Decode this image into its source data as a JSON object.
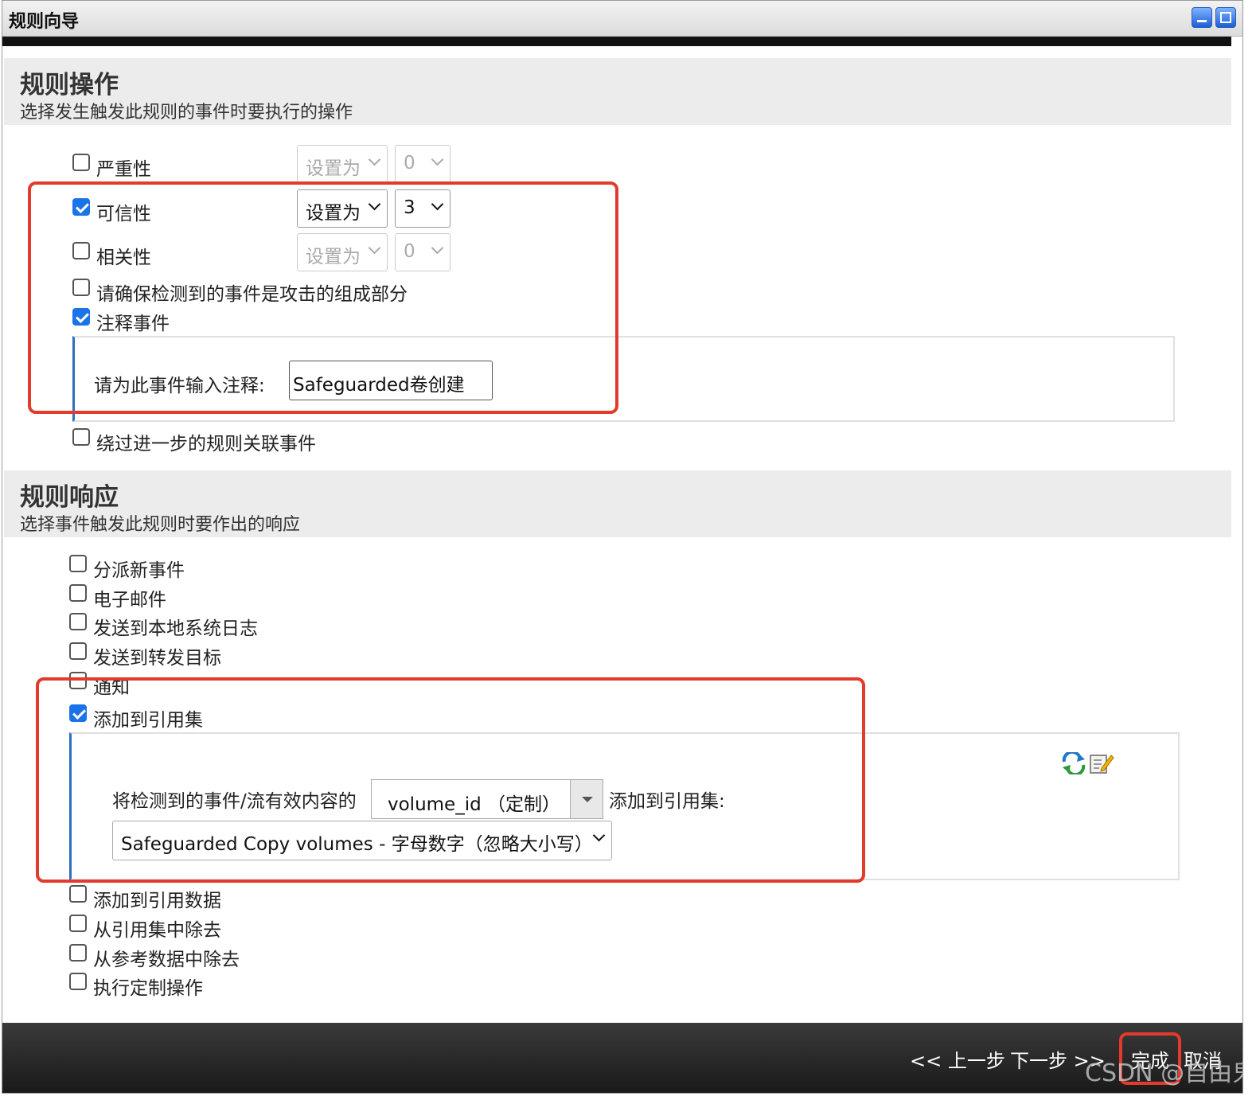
{
  "window": {
    "title": "规则向导"
  },
  "actions": {
    "title": "规则操作",
    "subtitle": "选择发生触发此规则的事件时要执行的操作",
    "severity": {
      "label": "严重性",
      "checked": false,
      "mode": "设置为",
      "value": "0"
    },
    "credibility": {
      "label": "可信性",
      "checked": true,
      "mode": "设置为",
      "value": "3"
    },
    "relevance": {
      "label": "相关性",
      "checked": false,
      "mode": "设置为",
      "value": "0"
    },
    "ensure_part_of_attack": {
      "label": "请确保检测到的事件是攻击的组成部分",
      "checked": false
    },
    "annotate_event": {
      "label": "注释事件",
      "checked": true
    },
    "annotation": {
      "label": "请为此事件输入注释:",
      "value": "Safeguarded卷创建"
    },
    "bypass_correlation": {
      "label": "绕过进一步的规则关联事件",
      "checked": false
    }
  },
  "responses": {
    "title": "规则响应",
    "subtitle": "选择事件触发此规则时要作出的响应",
    "dispatch_new_event": {
      "label": "分派新事件",
      "checked": false
    },
    "email": {
      "label": "电子邮件",
      "checked": false
    },
    "send_to_syslog": {
      "label": "发送到本地系统日志",
      "checked": false
    },
    "send_to_forward_target": {
      "label": "发送到转发目标",
      "checked": false
    },
    "notify": {
      "label": "通知",
      "checked": false
    },
    "add_to_reference_set": {
      "label": "添加到引用集",
      "checked": true
    },
    "reference_set_config": {
      "prefix": "将检测到的事件/流有效内容的",
      "field": "volume_id （定制）",
      "suffix": "添加到引用集:",
      "set": "Safeguarded Copy volumes - 字母数字（忽略大小写）"
    },
    "add_to_reference_data": {
      "label": "添加到引用数据",
      "checked": false
    },
    "remove_from_reference_set": {
      "label": "从引用集中除去",
      "checked": false
    },
    "remove_from_reference_data": {
      "label": "从参考数据中除去",
      "checked": false
    },
    "execute_custom_action": {
      "label": "执行定制操作",
      "checked": false
    }
  },
  "footer": {
    "back": "<< 上一步",
    "next": "下一步 >>",
    "finish": "完成",
    "cancel": "取消"
  },
  "watermark": "CSDN @自由鬼",
  "colors": {
    "highlight": "#e23b2e",
    "checkbox_checked": "#1a73e8"
  }
}
